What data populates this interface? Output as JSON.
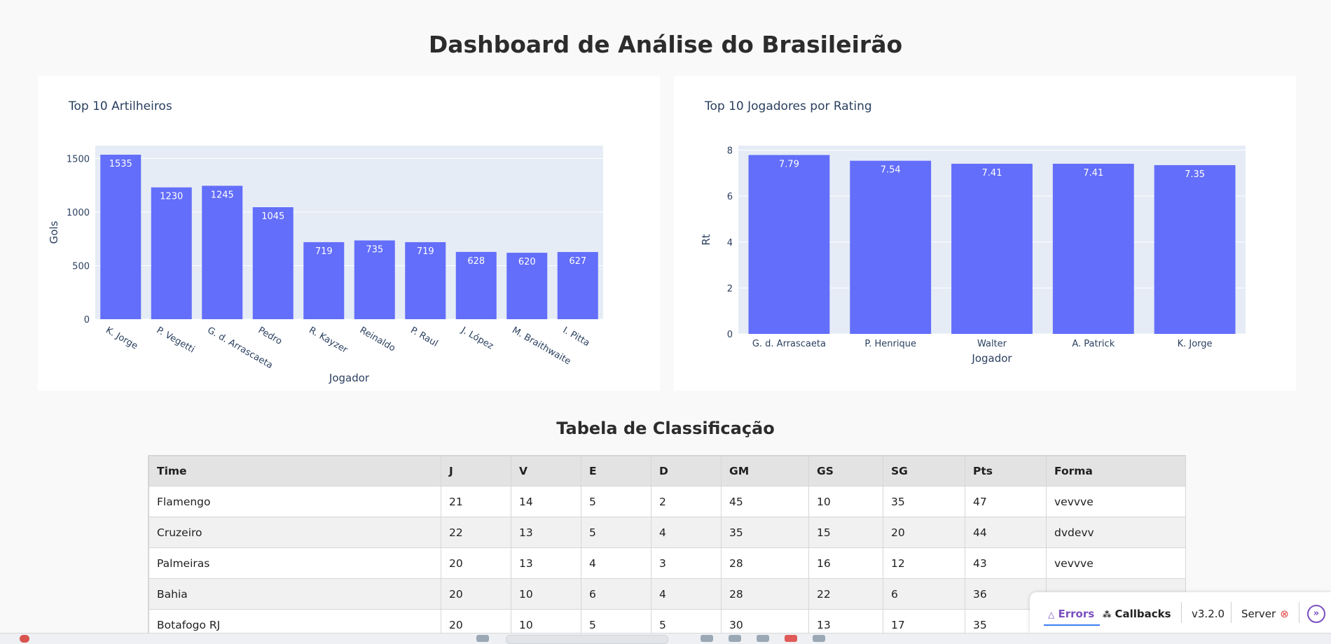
{
  "page": {
    "title": "Dashboard de Análise do Brasileirão",
    "table_title": "Tabela de Classificação"
  },
  "chart_data": [
    {
      "type": "bar",
      "title": "Top 10 Artilheiros",
      "xlabel": "Jogador",
      "ylabel": "Gols",
      "categories": [
        "K. Jorge",
        "P. Vegetti",
        "G. d. Arrascaeta",
        "Pedro",
        "R. Kayzer",
        "Reinaldo",
        "P. Raul",
        "J. López",
        "M. Braithwaite",
        "I. Pitta"
      ],
      "values": [
        1535,
        1230,
        1245,
        1045,
        719,
        735,
        719,
        628,
        620,
        627
      ],
      "ylim": [
        0,
        1620
      ],
      "yticks": [
        0,
        500,
        1000,
        1500
      ],
      "color": "#636efa",
      "grid": true
    },
    {
      "type": "bar",
      "title": "Top 10 Jogadores por Rating",
      "xlabel": "Jogador",
      "ylabel": "Rt",
      "categories": [
        "G. d. Arrascaeta",
        "P. Henrique",
        "Walter",
        "A. Patrick",
        "K. Jorge"
      ],
      "values": [
        7.79,
        7.54,
        7.41,
        7.41,
        7.35
      ],
      "ylim": [
        0,
        8.2
      ],
      "yticks": [
        0,
        2,
        4,
        6,
        8
      ],
      "color": "#636efa",
      "grid": true
    }
  ],
  "table": {
    "columns": [
      "Time",
      "J",
      "V",
      "E",
      "D",
      "GM",
      "GS",
      "SG",
      "Pts",
      "Forma"
    ],
    "rows": [
      [
        "Flamengo",
        "21",
        "14",
        "5",
        "2",
        "45",
        "10",
        "35",
        "47",
        "vevvve"
      ],
      [
        "Cruzeiro",
        "22",
        "13",
        "5",
        "4",
        "35",
        "15",
        "20",
        "44",
        "dvdevv"
      ],
      [
        "Palmeiras",
        "20",
        "13",
        "4",
        "3",
        "28",
        "16",
        "12",
        "43",
        "vevvve"
      ],
      [
        "Bahia",
        "20",
        "10",
        "6",
        "4",
        "28",
        "22",
        "6",
        "36",
        ""
      ],
      [
        "Botafogo RJ",
        "20",
        "10",
        "5",
        "5",
        "30",
        "13",
        "17",
        "35",
        ""
      ]
    ]
  },
  "debug": {
    "errors": "Errors",
    "callbacks": "Callbacks",
    "version": "v3.2.0",
    "server": "Server",
    "errors_icon": "warning-icon",
    "callbacks_icon": "callbacks-icon",
    "server_icon": "error-circle-icon",
    "toggle_icon": "double-chevron-right-icon"
  },
  "colors": {
    "bar": "#636efa",
    "plot_bg": "#e5ecf6",
    "accent": "#7a4fc0"
  }
}
